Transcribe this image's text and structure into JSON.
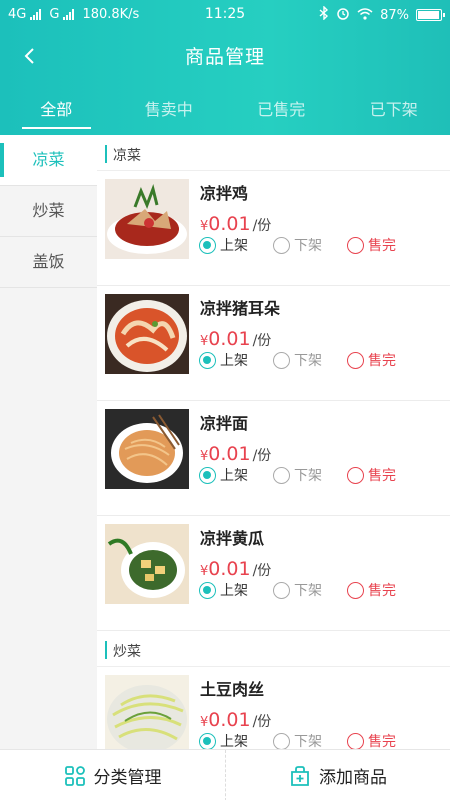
{
  "status": {
    "network_1": "4G",
    "network_2": "G",
    "speed": "180.8K/s",
    "time": "11:25",
    "battery_percent": "87%",
    "battery_level": 0.87
  },
  "nav": {
    "title": "商品管理"
  },
  "tabs": [
    "全部",
    "售卖中",
    "已售完",
    "已下架"
  ],
  "sidebar": {
    "items": [
      "凉菜",
      "炒菜",
      "盖饭"
    ]
  },
  "sections": [
    {
      "label": "凉菜",
      "products": [
        {
          "name": "凉拌鸡",
          "currency": "¥",
          "price": "0.01",
          "unit": "/份",
          "on": "上架",
          "off": "下架",
          "sold": "售完"
        },
        {
          "name": "凉拌猪耳朵",
          "currency": "¥",
          "price": "0.01",
          "unit": "/份",
          "on": "上架",
          "off": "下架",
          "sold": "售完"
        },
        {
          "name": "凉拌面",
          "currency": "¥",
          "price": "0.01",
          "unit": "/份",
          "on": "上架",
          "off": "下架",
          "sold": "售完"
        },
        {
          "name": "凉拌黄瓜",
          "currency": "¥",
          "price": "0.01",
          "unit": "/份",
          "on": "上架",
          "off": "下架",
          "sold": "售完"
        }
      ]
    },
    {
      "label": "炒菜",
      "products": [
        {
          "name": "土豆肉丝",
          "currency": "¥",
          "price": "0.01",
          "unit": "/份",
          "on": "上架",
          "off": "下架",
          "sold": "售完"
        }
      ]
    }
  ],
  "bottom": {
    "category_label": "分类管理",
    "add_label": "添加商品"
  },
  "icons": {
    "back": "chevron-left-icon",
    "category": "grid-icon",
    "add": "add-product-icon"
  },
  "colors": {
    "accent": "#1cc0bb",
    "price": "#e8434f"
  }
}
